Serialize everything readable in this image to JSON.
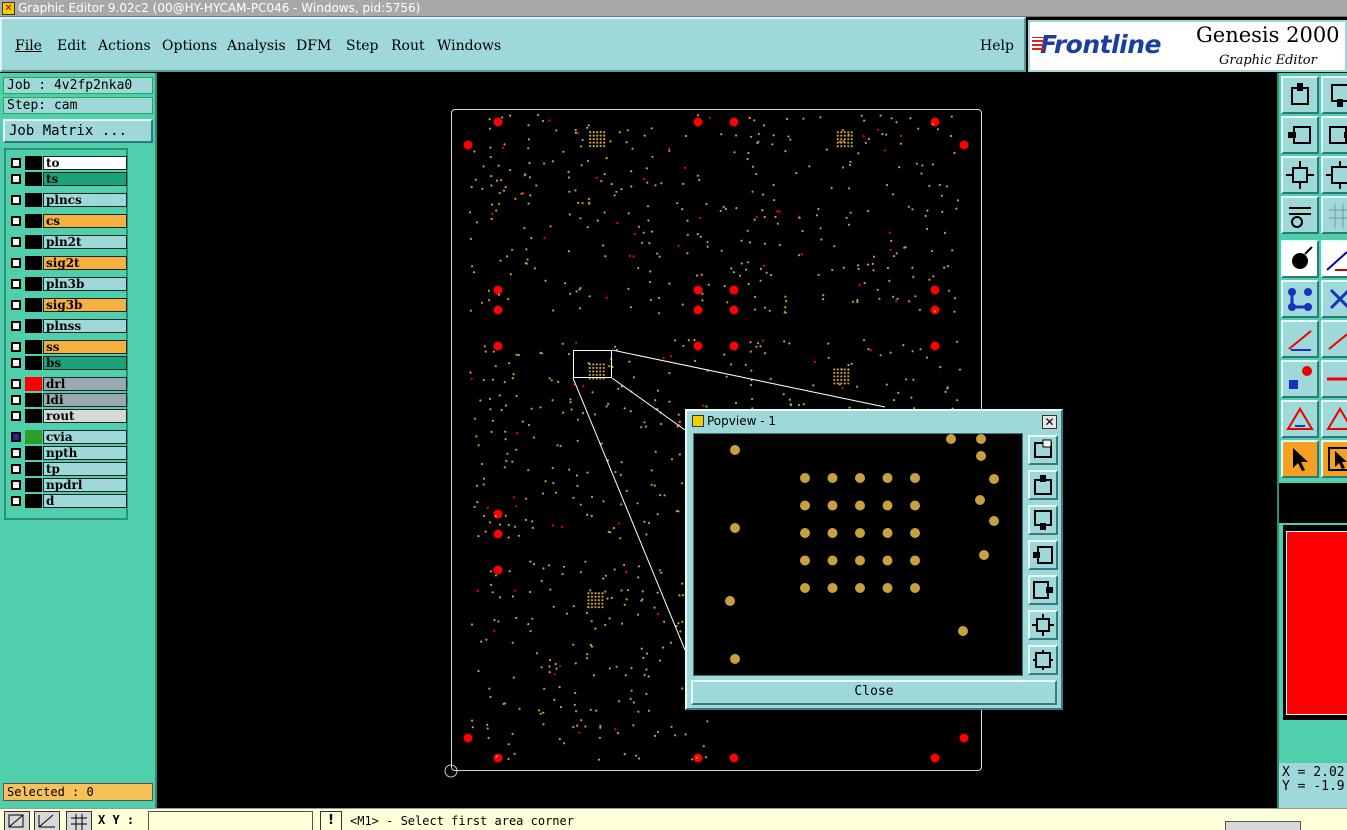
{
  "window": {
    "title": "Graphic Editor 9.02c2 (00@HY-HYCAM-PC046 - Windows, pid:5756)"
  },
  "menu": {
    "items": [
      {
        "id": "file",
        "label": "File"
      },
      {
        "id": "edit",
        "label": "Edit"
      },
      {
        "id": "actions",
        "label": "Actions"
      },
      {
        "id": "options",
        "label": "Options"
      },
      {
        "id": "analysis",
        "label": "Analysis"
      },
      {
        "id": "dfm",
        "label": "DFM"
      },
      {
        "id": "step",
        "label": "Step"
      },
      {
        "id": "rout",
        "label": "Rout"
      },
      {
        "id": "windows",
        "label": "Windows"
      }
    ],
    "help": "Help"
  },
  "brand": {
    "logo_text": "Frontline",
    "product": "Genesis 2000",
    "subtitle": "Graphic Editor"
  },
  "job": {
    "job_label": "Job : 4v2fp2nka0",
    "step_label": "Step: cam",
    "matrix_button": "Job Matrix ..."
  },
  "layers": [
    {
      "name": "to",
      "bg": "#ffffff",
      "swatch": "#000000",
      "sel": false
    },
    {
      "name": "ts",
      "bg": "#1aa37a",
      "swatch": "#000000",
      "sel": false
    },
    {
      "name": "plncs",
      "bg": "#9ed8d8",
      "swatch": "#000000",
      "sel": false
    },
    {
      "name": "cs",
      "bg": "#f5b040",
      "swatch": "#000000",
      "sel": false
    },
    {
      "name": "pln2t",
      "bg": "#9ed8d8",
      "swatch": "#000000",
      "sel": false
    },
    {
      "name": "sig2t",
      "bg": "#f5b040",
      "swatch": "#000000",
      "sel": false
    },
    {
      "name": "pln3b",
      "bg": "#9ed8d8",
      "swatch": "#000000",
      "sel": false
    },
    {
      "name": "sig3b",
      "bg": "#f5b040",
      "swatch": "#000000",
      "sel": false
    },
    {
      "name": "plnss",
      "bg": "#9ed8d8",
      "swatch": "#000000",
      "sel": false
    },
    {
      "name": "ss",
      "bg": "#f5b040",
      "swatch": "#000000",
      "sel": false
    },
    {
      "name": "bs",
      "bg": "#1aa37a",
      "swatch": "#000000",
      "sel": false
    },
    {
      "name": "drl",
      "bg": "#9aa8b0",
      "swatch": "#ff0000",
      "sel": false
    },
    {
      "name": "ldi",
      "bg": "#9aa8b0",
      "swatch": "#000000",
      "sel": false
    },
    {
      "name": "rout",
      "bg": "#d8d8d8",
      "swatch": "#000000",
      "sel": false
    },
    {
      "name": "cvia",
      "bg": "#9ed8d8",
      "swatch": "#2aa02a",
      "sel": true
    },
    {
      "name": "npth",
      "bg": "#9ed8d8",
      "swatch": "#000000",
      "sel": false
    },
    {
      "name": "tp",
      "bg": "#9ed8d8",
      "swatch": "#000000",
      "sel": false
    },
    {
      "name": "npdrl",
      "bg": "#9ed8d8",
      "swatch": "#000000",
      "sel": false
    },
    {
      "name": "d",
      "bg": "#9ed8d8",
      "swatch": "#000000",
      "sel": false
    }
  ],
  "selected_label": "Selected : 0",
  "popview": {
    "title": "Popview - 1",
    "close_label": "Close"
  },
  "coords": {
    "x": "X = 2.02",
    "y": "Y = -1.9"
  },
  "status": {
    "xy_label": "X Y :",
    "xy_value": "",
    "excl": "!",
    "message": "<M1> - Select first area corner"
  },
  "colors": {
    "drill": "#ff0000",
    "pad": "#c8a040",
    "board_outline": "#d8d8d8",
    "panel": "#4fcfab",
    "menu_bg": "#9ed8d8"
  },
  "icons": [
    "pan-up-icon",
    "pan-down-icon",
    "pan-left-icon",
    "pan-right-icon",
    "zoom-fit-icon",
    "zoom-profile-icon",
    "settings-icon",
    "grid-icon",
    "snap-icon",
    "measure-icon",
    "connect-icon",
    "cross-icon",
    "line-icon",
    "arrow-icon",
    "select-icon",
    "select-orange-icon"
  ]
}
